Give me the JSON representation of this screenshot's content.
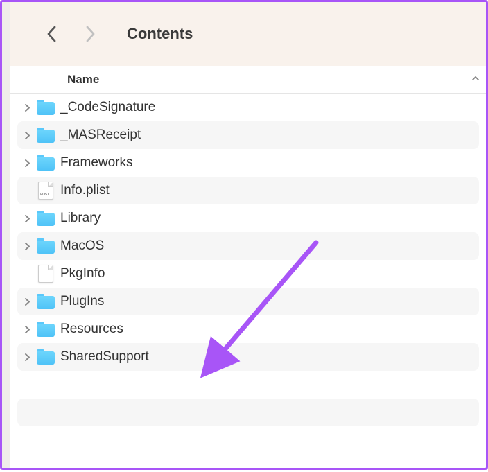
{
  "toolbar": {
    "title": "Contents"
  },
  "columnHeader": {
    "name": "Name"
  },
  "items": [
    {
      "name": "_CodeSignature",
      "type": "folder",
      "expandable": true
    },
    {
      "name": "_MASReceipt",
      "type": "folder",
      "expandable": true
    },
    {
      "name": "Frameworks",
      "type": "folder",
      "expandable": true
    },
    {
      "name": "Info.plist",
      "type": "plist",
      "expandable": false
    },
    {
      "name": "Library",
      "type": "folder",
      "expandable": true
    },
    {
      "name": "MacOS",
      "type": "folder",
      "expandable": true
    },
    {
      "name": "PkgInfo",
      "type": "file",
      "expandable": false
    },
    {
      "name": "PlugIns",
      "type": "folder",
      "expandable": true
    },
    {
      "name": "Resources",
      "type": "folder",
      "expandable": true
    },
    {
      "name": "SharedSupport",
      "type": "folder",
      "expandable": true
    }
  ],
  "annotation": {
    "color": "#a855f7",
    "target": "SharedSupport"
  }
}
